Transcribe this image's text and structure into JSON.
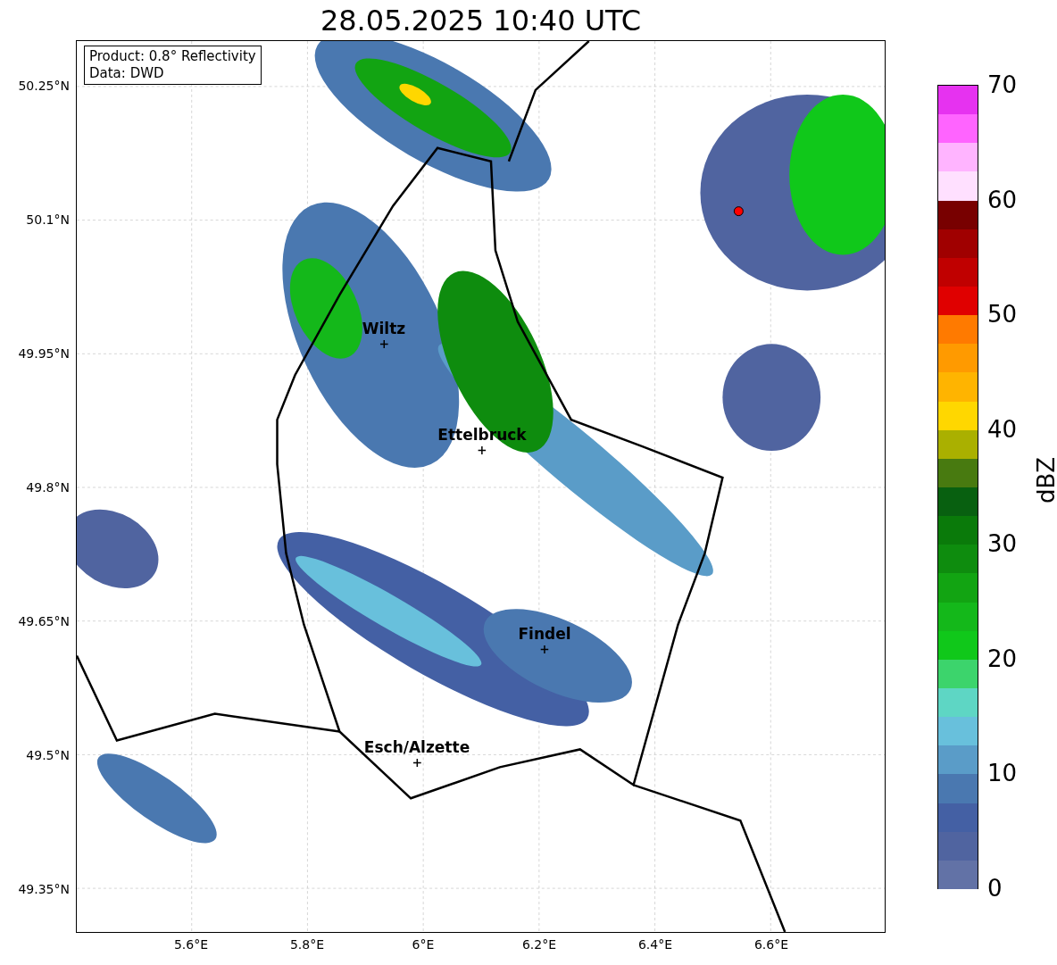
{
  "title": "28.05.2025 10:40 UTC",
  "info_box": [
    "Product: 0.8° Reflectivity",
    "Data: DWD"
  ],
  "map": {
    "x_ticks": [
      "5.6°E",
      "5.8°E",
      "6°E",
      "6.2°E",
      "6.4°E",
      "6.6°E"
    ],
    "y_ticks": [
      "50.25°N",
      "50.1°N",
      "49.95°N",
      "49.8°N",
      "49.65°N",
      "49.5°N",
      "49.35°N"
    ],
    "cities": [
      {
        "name": "Wiltz"
      },
      {
        "name": "Ettelbruck"
      },
      {
        "name": "Findel"
      },
      {
        "name": "Esch/Alzette"
      }
    ]
  },
  "colorbar": {
    "label": "dBZ",
    "ticks": [
      "70",
      "60",
      "50",
      "40",
      "30",
      "20",
      "10",
      "0"
    ],
    "segments": [
      {
        "color": "#e632f0"
      },
      {
        "color": "#ff64ff"
      },
      {
        "color": "#ffb4ff"
      },
      {
        "color": "#ffe0ff"
      },
      {
        "color": "#780000"
      },
      {
        "color": "#a00000"
      },
      {
        "color": "#c00000"
      },
      {
        "color": "#e00000"
      },
      {
        "color": "#ff7a00"
      },
      {
        "color": "#ff9a00"
      },
      {
        "color": "#ffb400"
      },
      {
        "color": "#ffd700"
      },
      {
        "color": "#aab000"
      },
      {
        "color": "#487a10"
      },
      {
        "color": "#086010"
      },
      {
        "color": "#0a7a0a"
      },
      {
        "color": "#0e8c0e"
      },
      {
        "color": "#12a412"
      },
      {
        "color": "#14b81a"
      },
      {
        "color": "#10c81a"
      },
      {
        "color": "#3cd46c"
      },
      {
        "color": "#5ed6c4"
      },
      {
        "color": "#68c0dc"
      },
      {
        "color": "#5a9cc8"
      },
      {
        "color": "#4a78b0"
      },
      {
        "color": "#4460a4"
      },
      {
        "color": "#5064a0"
      },
      {
        "color": "#6272a6"
      }
    ]
  }
}
